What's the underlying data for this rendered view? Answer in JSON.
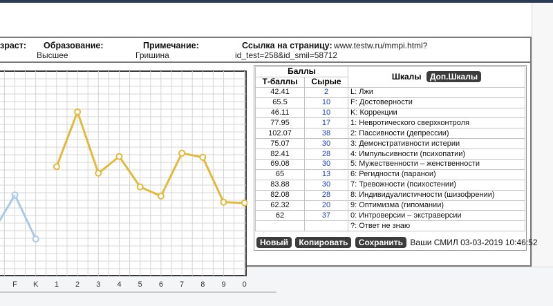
{
  "info": {
    "age_label": "зраст:",
    "education_label": "Образование:",
    "education_value": "Высшее",
    "note_label": "Примечание:",
    "note_value": "Гришина",
    "link_label": "Ссылка на страницу:",
    "link_url": "www.testw.ru/mmpi.html?",
    "link_params": "id_test=258&id_smil=58712"
  },
  "table": {
    "header_balls": "Баллы",
    "header_t": "Т-баллы",
    "header_raw": "Сырые",
    "header_scales": "Шкалы",
    "dop_button": "Доп.Шкалы",
    "rows": [
      {
        "t": "42.41",
        "raw": "2",
        "name": "L: Лжи"
      },
      {
        "t": "65.5",
        "raw": "10",
        "name": "F: Достоверности"
      },
      {
        "t": "46.11",
        "raw": "10",
        "name": "K: Коррекции"
      },
      {
        "t": "77.95",
        "raw": "17",
        "name": "1: Невротического сверхконтроля"
      },
      {
        "t": "102.07",
        "raw": "38",
        "name": "2: Пассивности (депрессии)"
      },
      {
        "t": "75.07",
        "raw": "30",
        "name": "3: Демонстративности истерии"
      },
      {
        "t": "82.41",
        "raw": "28",
        "name": "4: Импульсивности (психопатии)"
      },
      {
        "t": "69.08",
        "raw": "30",
        "name": "5: Мужественности – женственности"
      },
      {
        "t": "65",
        "raw": "13",
        "name": "6: Регидности (паранои)"
      },
      {
        "t": "83.88",
        "raw": "30",
        "name": "7: Тревожности (психостении)"
      },
      {
        "t": "82.08",
        "raw": "28",
        "name": "8: Индивидуалистичности (шизофрении)"
      },
      {
        "t": "62.32",
        "raw": "20",
        "name": "9: Оптимизма (гипомании)"
      },
      {
        "t": "62",
        "raw": "37",
        "name": "0: Интроверсии – экстраверсии"
      },
      {
        "t": "",
        "raw": "",
        "name": "?: Ответ не знаю"
      }
    ]
  },
  "actions": {
    "new_label": "Новый",
    "copy_label": "Копировать",
    "save_label": "Сохранить",
    "stamp": "Ваши СМИЛ 03-03-2019 10:46:52"
  },
  "chart_data": {
    "type": "line",
    "categories": [
      "F",
      "K",
      "1",
      "2",
      "3",
      "4",
      "5",
      "6",
      "7",
      "8",
      "9",
      "0"
    ],
    "series": [
      {
        "color": "#a9c9e6",
        "categories": [
          "F",
          "K"
        ],
        "values": [
          65.5,
          46.11
        ]
      },
      {
        "color": "#e2b93b",
        "categories": [
          "1",
          "2",
          "3",
          "4",
          "5",
          "6",
          "7",
          "8",
          "9",
          "0"
        ],
        "values": [
          77.95,
          102.07,
          75.07,
          82.41,
          69.08,
          65,
          83.88,
          82.08,
          62.32,
          62
        ]
      }
    ],
    "grid": true
  }
}
